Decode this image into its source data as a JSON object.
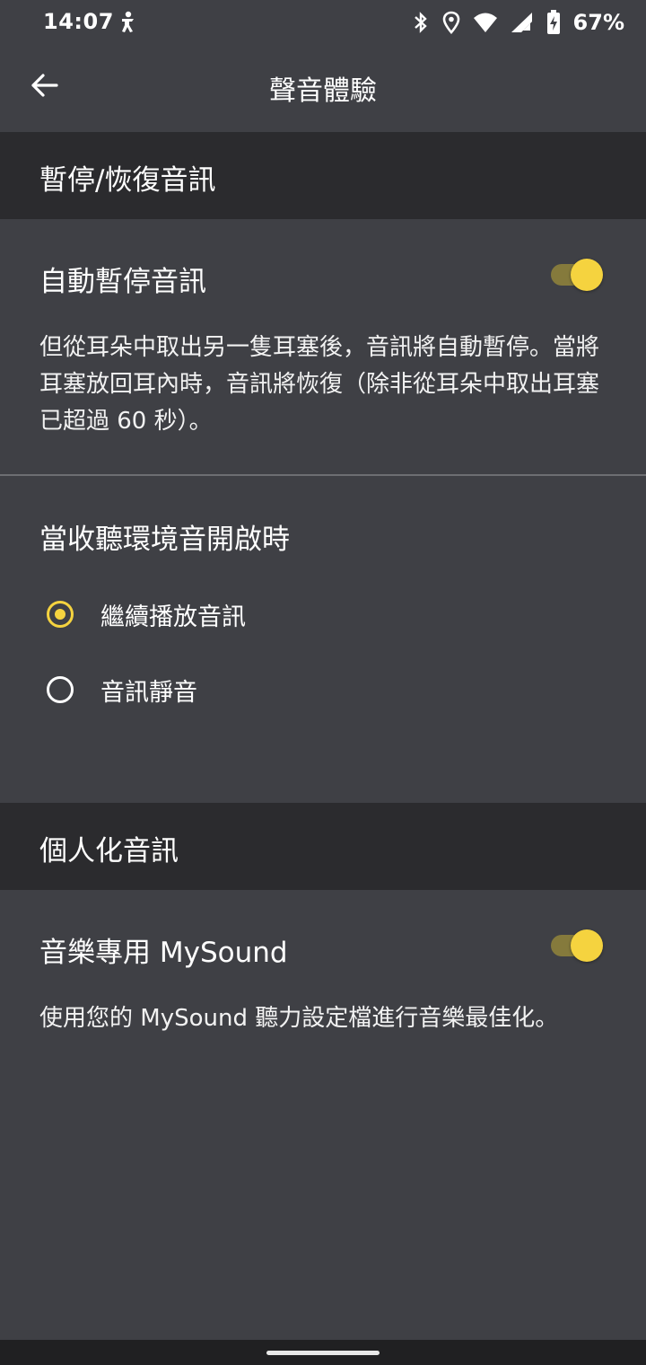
{
  "status_bar": {
    "time": "14:07",
    "icons": [
      "accessibility-icon",
      "bluetooth-icon",
      "location-icon",
      "wifi-icon",
      "signal-icon",
      "battery-charging-icon"
    ],
    "battery": "67%"
  },
  "app_bar": {
    "back_icon": "arrow-left-icon",
    "title": "聲音體驗"
  },
  "section_pause": {
    "header": "暫停/恢復音訊",
    "auto_pause": {
      "label": "自動暫停音訊",
      "enabled": true,
      "description": "但從耳朵中取出另一隻耳塞後，音訊將自動暫停。當將耳塞放回耳內時，音訊將恢復（除非從耳朵中取出耳塞已超過 60 秒）。"
    },
    "ambient": {
      "label": "當收聽環境音開啟時",
      "options": [
        {
          "label": "繼續播放音訊",
          "selected": true
        },
        {
          "label": "音訊靜音",
          "selected": false
        }
      ]
    }
  },
  "section_personal": {
    "header": "個人化音訊",
    "mysound": {
      "label": "音樂專用 MySound",
      "enabled": true,
      "description": "使用您的 MySound 聽力設定檔進行音樂最佳化。"
    }
  },
  "colors": {
    "accent": "#f5d33f",
    "background": "#3f4045",
    "section_header_bg": "#2b2b2e"
  }
}
